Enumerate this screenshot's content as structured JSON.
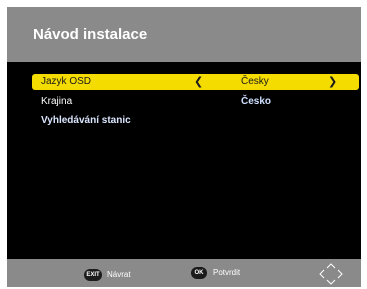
{
  "header": {
    "title": "Návod instalace"
  },
  "menu": [
    {
      "label": "Jazyk OSD",
      "value": "Česky",
      "arrow_left": "❮",
      "arrow_right": "❯",
      "selected": true
    },
    {
      "label": "Krajina",
      "value": "Česko",
      "selected": false
    },
    {
      "label": "Vyhledávání stanic",
      "selected": false
    }
  ],
  "footer": {
    "exit_key": "EXIT",
    "exit_label": "Návrat",
    "ok_key": "OK",
    "ok_label": "Potvrdit",
    "nav_icon": "dpad-arrows-icon"
  },
  "colors": {
    "header_bg": "#8a8a8a",
    "highlight": "#f4db00",
    "value_text": "#cfe0ff"
  }
}
